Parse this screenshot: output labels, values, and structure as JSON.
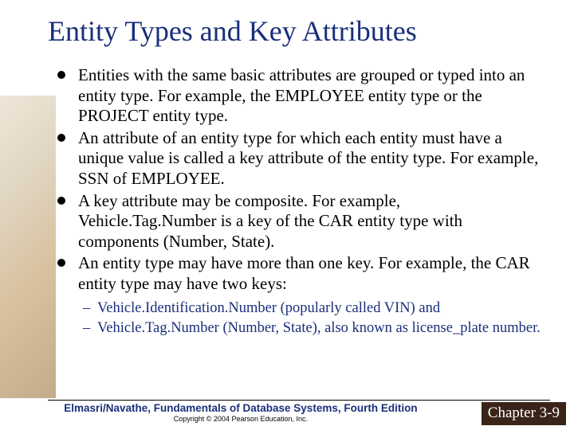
{
  "title": "Entity Types and Key Attributes",
  "bullets": [
    "Entities with the same basic attributes are grouped or typed into an entity type. For example, the EMPLOYEE entity type or the PROJECT entity type.",
    "An attribute of an entity type for which each entity must have a unique value is called a key attribute of the entity type. For example, SSN of EMPLOYEE.",
    "A key attribute may be composite. For example, Vehicle.Tag.Number is a key of the CAR entity type with components (Number, State).",
    "An entity type may have more than one key. For example, the CAR entity type may have two keys:"
  ],
  "subbullets": [
    "Vehicle.Identification.Number (popularly called VIN) and",
    "Vehicle.Tag.Number (Number, State), also known as license_plate number."
  ],
  "footer": {
    "book": "Elmasri/Navathe, Fundamentals of Database Systems, Fourth Edition",
    "copyright": "Copyright © 2004 Pearson Education, Inc.",
    "chapter": "Chapter 3-9"
  }
}
